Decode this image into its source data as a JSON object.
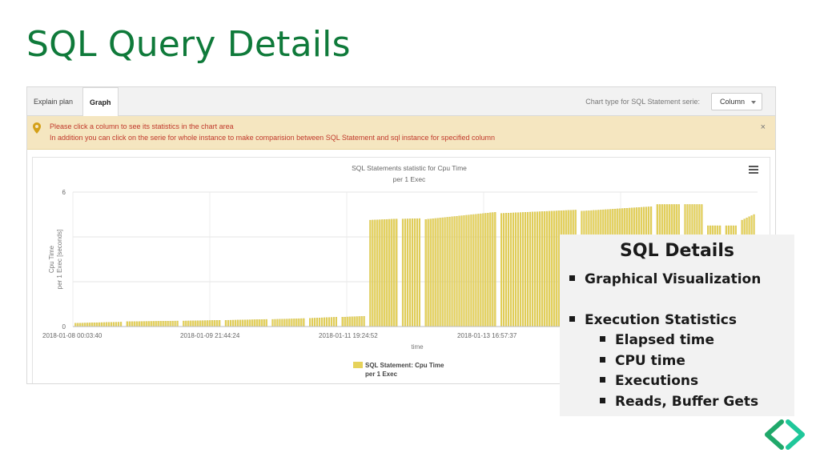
{
  "slide": {
    "title": "SQL Query Details"
  },
  "tabs": [
    {
      "label": "Explain plan",
      "active": false
    },
    {
      "label": "Graph",
      "active": true
    }
  ],
  "toolbar": {
    "chart_type_label": "Chart type for SQL Statement serie:",
    "chart_type_value": "Column"
  },
  "alert": {
    "line1": "Please click a column to see its statistics in the chart area",
    "line2": "In addition you can click on the serie for whole instance to make comparision between SQL Statement and sql instance for specified column",
    "close": "×"
  },
  "colors": {
    "title_green": "#0f7a3a",
    "bar_fill": "#e6d25a",
    "bar_stroke": "#c9b53a",
    "alert_bg": "#f5e6c0",
    "alert_text": "#c0392b"
  },
  "chart_data": {
    "type": "bar",
    "title": "SQL Statements statistic for Cpu Time",
    "subtitle": "per 1 Exec",
    "xlabel": "time",
    "ylabel_lines": [
      "Cpu Time",
      "per 1 Exec [seconds]"
    ],
    "ylim": [
      0,
      6
    ],
    "yticks": [
      0,
      2,
      4,
      6
    ],
    "ytick_labels": [
      "0",
      "",
      "",
      "6"
    ],
    "xtick_labels": [
      "2018-01-08 00:03:40",
      "2018-01-09 21:44:24",
      "2018-01-11 19:24:52",
      "2018-01-13 16:57:37"
    ],
    "grid": true,
    "legend": {
      "label_lines": [
        "SQL Statement: Cpu Time",
        "per 1 Exec"
      ],
      "placement": "bottom"
    },
    "series": [
      {
        "name": "SQL Statement: Cpu Time per 1 Exec",
        "groups": [
          {
            "count": 20,
            "start": 0.15,
            "end": 0.2
          },
          {
            "count": 22,
            "start": 0.22,
            "end": 0.25
          },
          {
            "count": 16,
            "start": 0.25,
            "end": 0.28
          },
          {
            "count": 18,
            "start": 0.28,
            "end": 0.32
          },
          {
            "count": 14,
            "start": 0.32,
            "end": 0.36
          },
          {
            "count": 12,
            "start": 0.37,
            "end": 0.42
          },
          {
            "count": 10,
            "start": 0.42,
            "end": 0.46
          },
          {
            "count": 12,
            "start": 4.75,
            "end": 4.8
          },
          {
            "count": 8,
            "start": 4.8,
            "end": 4.82
          },
          {
            "count": 30,
            "start": 4.78,
            "end": 5.1
          },
          {
            "count": 32,
            "start": 5.05,
            "end": 5.2
          },
          {
            "count": 30,
            "start": 5.15,
            "end": 5.35
          },
          {
            "count": 10,
            "start": 5.45,
            "end": 5.45
          },
          {
            "count": 8,
            "start": 5.45,
            "end": 5.45
          },
          {
            "count": 6,
            "start": 4.5,
            "end": 4.5
          },
          {
            "count": 5,
            "start": 4.5,
            "end": 4.5
          },
          {
            "count": 6,
            "start": 4.75,
            "end": 5.0
          }
        ]
      }
    ]
  },
  "overlay": {
    "heading": "SQL Details",
    "items": [
      {
        "text": "Graphical Visualization",
        "level": 1
      },
      {
        "text": "Execution Statistics",
        "level": 1
      },
      {
        "text": "Elapsed time",
        "level": 2
      },
      {
        "text": "CPU time",
        "level": 2
      },
      {
        "text": "Executions",
        "level": 2
      },
      {
        "text": "Reads, Buffer Gets",
        "level": 2
      }
    ]
  },
  "icons": {
    "alert": "map-pin-icon",
    "menu": "hamburger-menu-icon",
    "logo": "chevron-brackets-logo-icon"
  }
}
